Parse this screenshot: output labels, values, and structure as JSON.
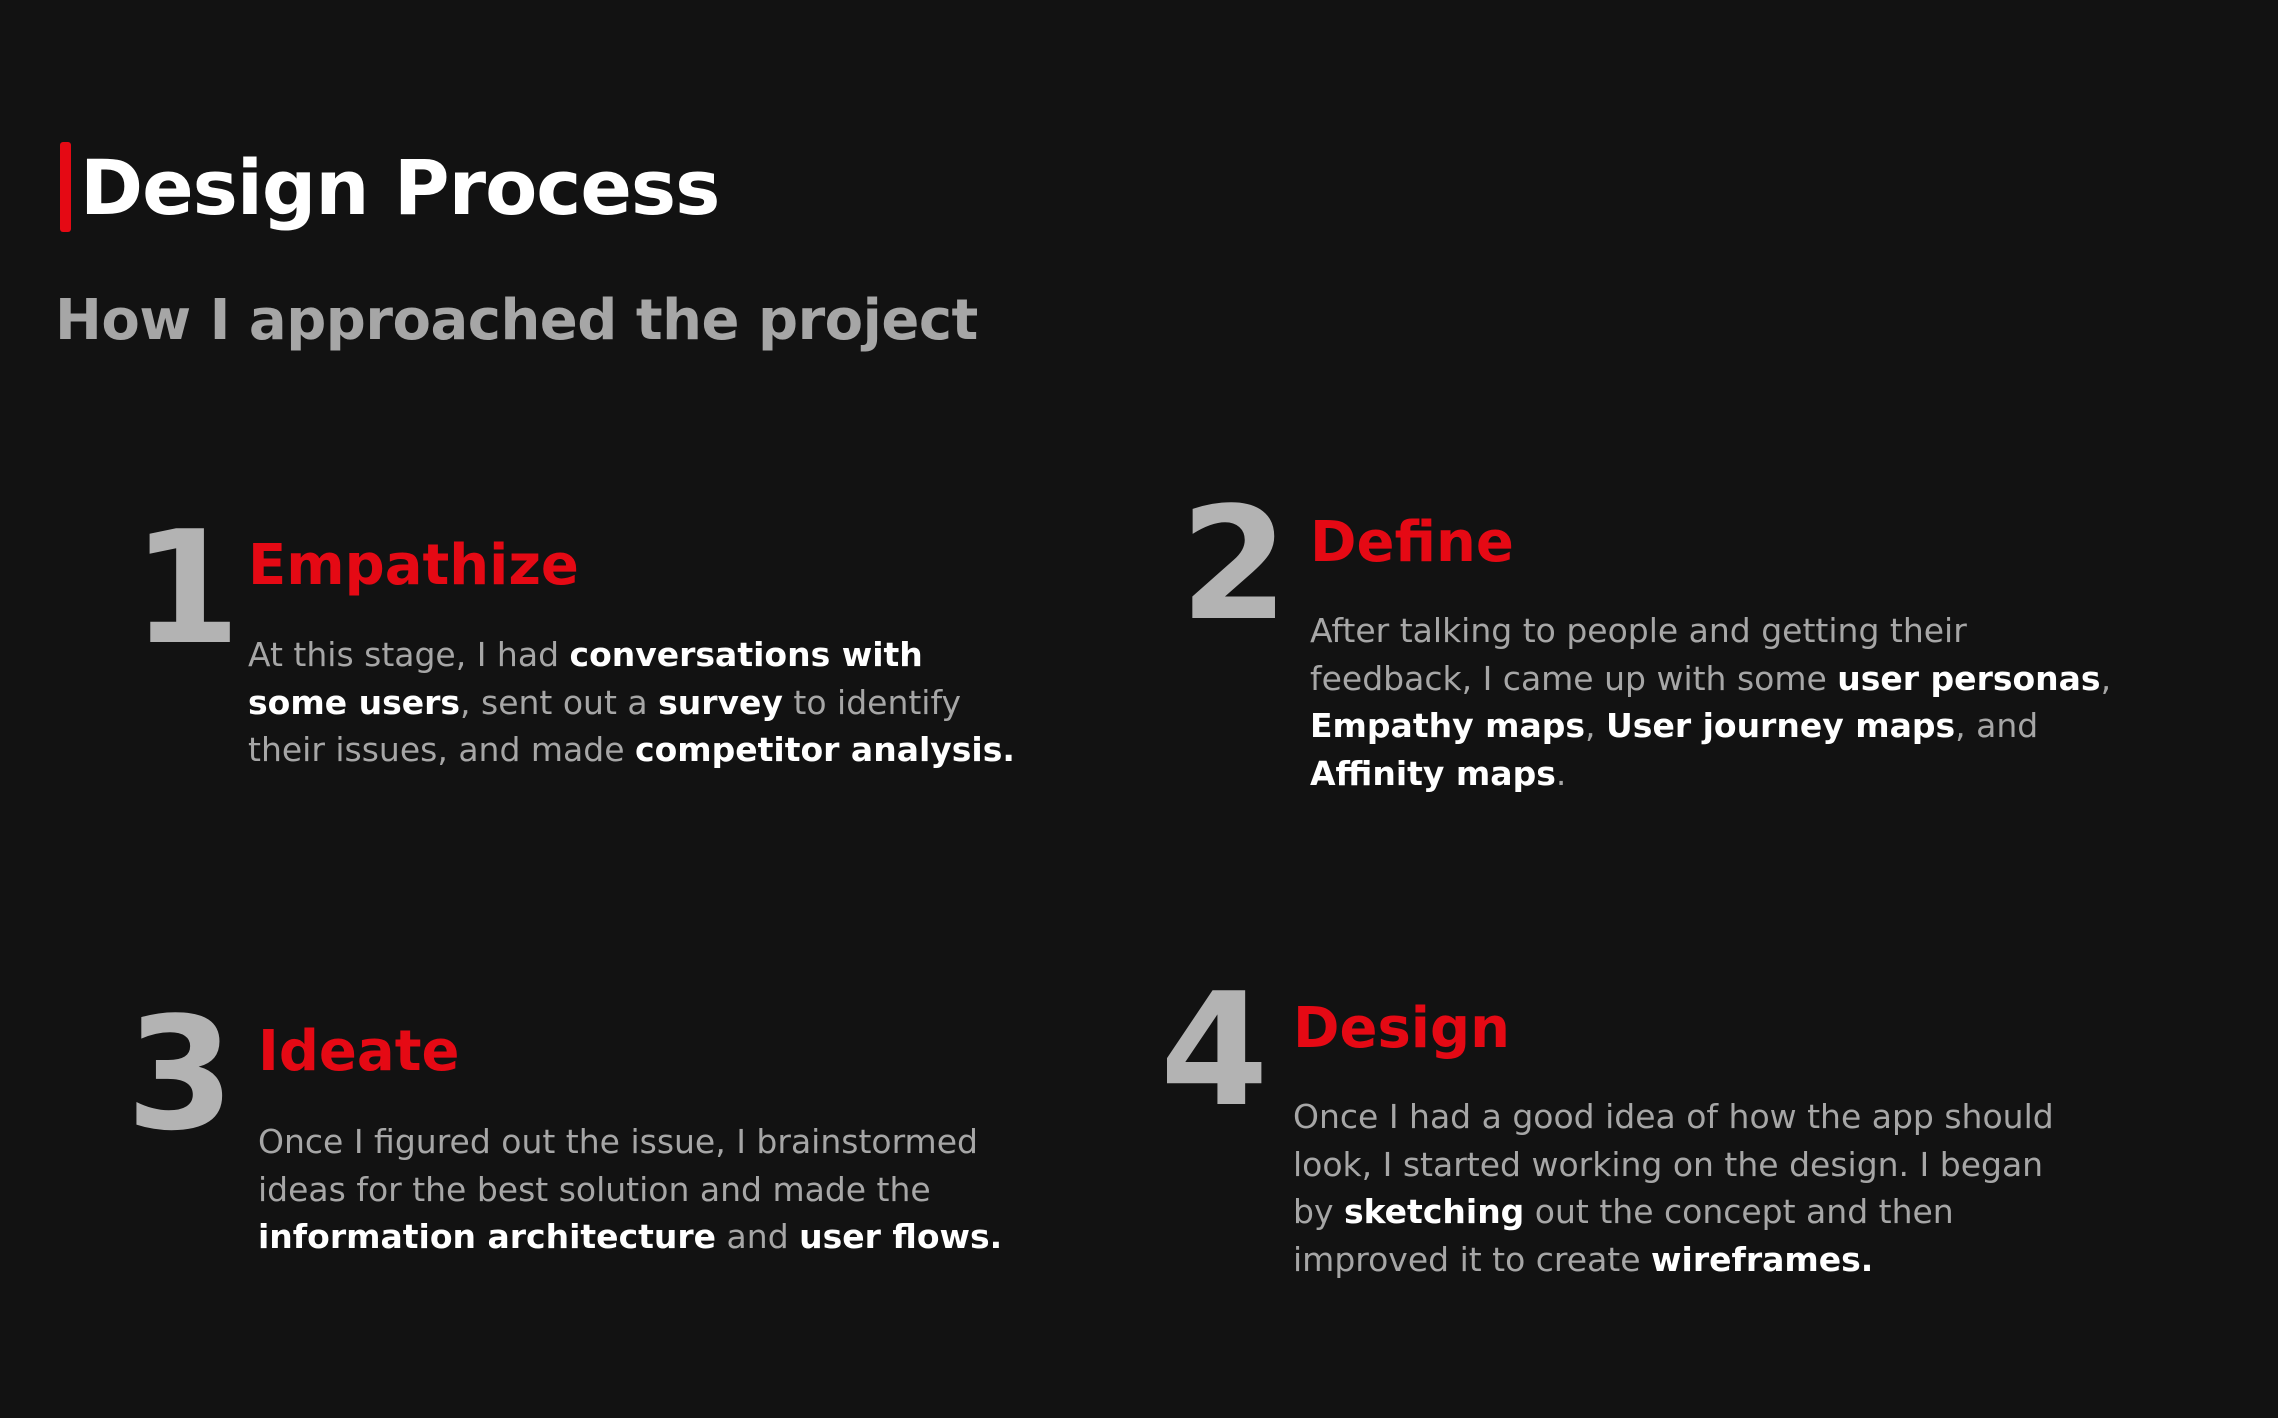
{
  "header": {
    "title": "Design Process",
    "subtitle": "How I approached the project",
    "accent_color": "#e50914"
  },
  "steps": [
    {
      "number": "1",
      "title": "Empathize",
      "text": {
        "s1": "At this stage, I had ",
        "b1": "conversations with",
        "b2": "some users",
        "s2": ", sent out a ",
        "b3": "survey",
        "s3": " to identify",
        "s4": "their issues, and made ",
        "b4": "competitor analysis."
      }
    },
    {
      "number": "2",
      "title": "Define",
      "text": {
        "s1": "After talking to people and getting their",
        "s2": "feedback, I came up with some ",
        "b1": "user personas",
        "s3": ",",
        "b2": "Empathy maps",
        "s4": ", ",
        "b3": "User journey maps",
        "s5": ", and",
        "b4": "Affinity maps",
        "s6": "."
      }
    },
    {
      "number": "3",
      "title": "Ideate",
      "text": {
        "s1": "Once I figured out the issue, I brainstormed",
        "s2": "ideas for the best solution and made the",
        "b1": "information architecture",
        "s3": " and ",
        "b2": "user flows."
      }
    },
    {
      "number": "4",
      "title": "Design",
      "text": {
        "s1": "Once I had a good idea of how the app should",
        "s2": "look, I started working on the design. I began",
        "s3": "by ",
        "b1": "sketching",
        "s4": " out the concept and then",
        "s5": "improved it to create ",
        "b2": "wireframes."
      }
    }
  ]
}
